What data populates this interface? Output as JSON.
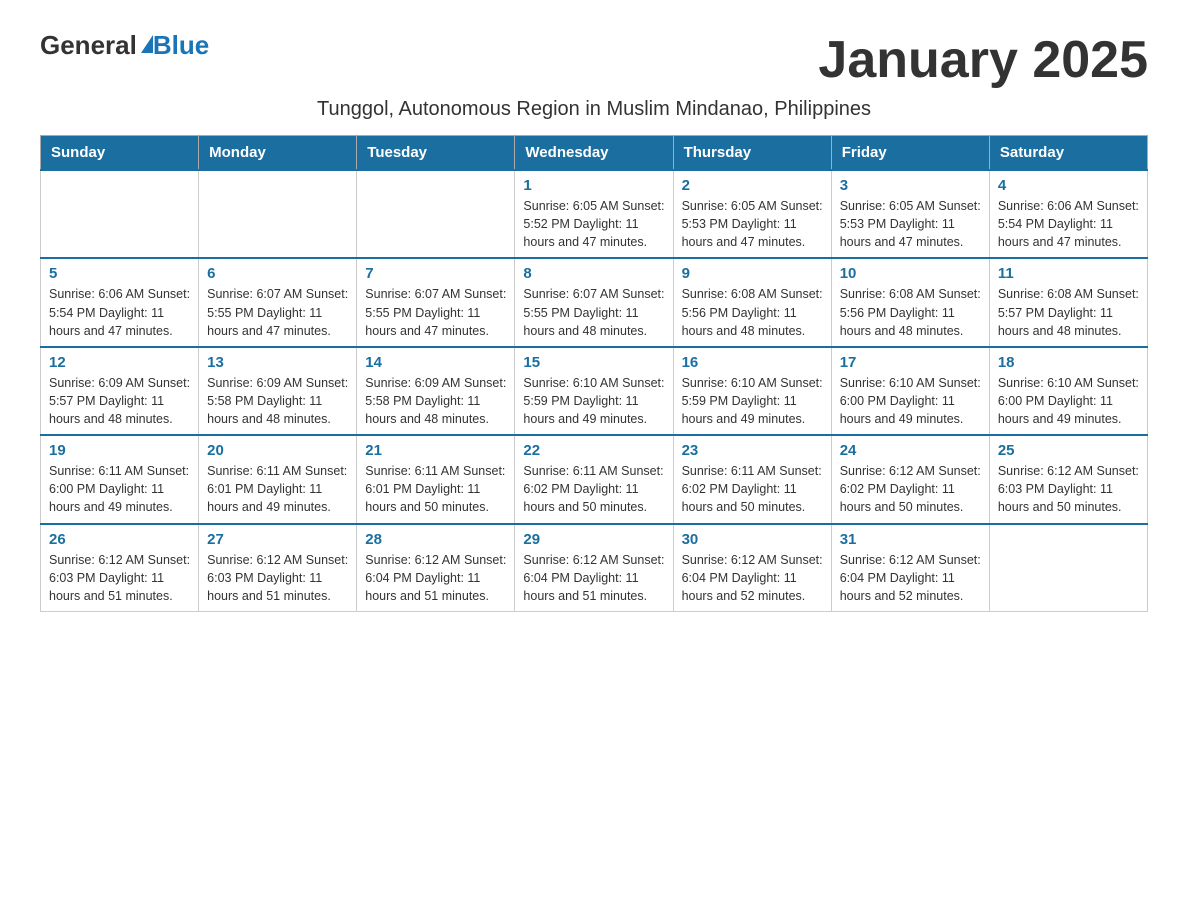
{
  "header": {
    "logo_general": "General",
    "logo_blue": "Blue",
    "month_title": "January 2025",
    "subtitle": "Tunggol, Autonomous Region in Muslim Mindanao, Philippines"
  },
  "weekdays": [
    "Sunday",
    "Monday",
    "Tuesday",
    "Wednesday",
    "Thursday",
    "Friday",
    "Saturday"
  ],
  "weeks": [
    [
      {
        "day": "",
        "info": ""
      },
      {
        "day": "",
        "info": ""
      },
      {
        "day": "",
        "info": ""
      },
      {
        "day": "1",
        "info": "Sunrise: 6:05 AM\nSunset: 5:52 PM\nDaylight: 11 hours and 47 minutes."
      },
      {
        "day": "2",
        "info": "Sunrise: 6:05 AM\nSunset: 5:53 PM\nDaylight: 11 hours and 47 minutes."
      },
      {
        "day": "3",
        "info": "Sunrise: 6:05 AM\nSunset: 5:53 PM\nDaylight: 11 hours and 47 minutes."
      },
      {
        "day": "4",
        "info": "Sunrise: 6:06 AM\nSunset: 5:54 PM\nDaylight: 11 hours and 47 minutes."
      }
    ],
    [
      {
        "day": "5",
        "info": "Sunrise: 6:06 AM\nSunset: 5:54 PM\nDaylight: 11 hours and 47 minutes."
      },
      {
        "day": "6",
        "info": "Sunrise: 6:07 AM\nSunset: 5:55 PM\nDaylight: 11 hours and 47 minutes."
      },
      {
        "day": "7",
        "info": "Sunrise: 6:07 AM\nSunset: 5:55 PM\nDaylight: 11 hours and 47 minutes."
      },
      {
        "day": "8",
        "info": "Sunrise: 6:07 AM\nSunset: 5:55 PM\nDaylight: 11 hours and 48 minutes."
      },
      {
        "day": "9",
        "info": "Sunrise: 6:08 AM\nSunset: 5:56 PM\nDaylight: 11 hours and 48 minutes."
      },
      {
        "day": "10",
        "info": "Sunrise: 6:08 AM\nSunset: 5:56 PM\nDaylight: 11 hours and 48 minutes."
      },
      {
        "day": "11",
        "info": "Sunrise: 6:08 AM\nSunset: 5:57 PM\nDaylight: 11 hours and 48 minutes."
      }
    ],
    [
      {
        "day": "12",
        "info": "Sunrise: 6:09 AM\nSunset: 5:57 PM\nDaylight: 11 hours and 48 minutes."
      },
      {
        "day": "13",
        "info": "Sunrise: 6:09 AM\nSunset: 5:58 PM\nDaylight: 11 hours and 48 minutes."
      },
      {
        "day": "14",
        "info": "Sunrise: 6:09 AM\nSunset: 5:58 PM\nDaylight: 11 hours and 48 minutes."
      },
      {
        "day": "15",
        "info": "Sunrise: 6:10 AM\nSunset: 5:59 PM\nDaylight: 11 hours and 49 minutes."
      },
      {
        "day": "16",
        "info": "Sunrise: 6:10 AM\nSunset: 5:59 PM\nDaylight: 11 hours and 49 minutes."
      },
      {
        "day": "17",
        "info": "Sunrise: 6:10 AM\nSunset: 6:00 PM\nDaylight: 11 hours and 49 minutes."
      },
      {
        "day": "18",
        "info": "Sunrise: 6:10 AM\nSunset: 6:00 PM\nDaylight: 11 hours and 49 minutes."
      }
    ],
    [
      {
        "day": "19",
        "info": "Sunrise: 6:11 AM\nSunset: 6:00 PM\nDaylight: 11 hours and 49 minutes."
      },
      {
        "day": "20",
        "info": "Sunrise: 6:11 AM\nSunset: 6:01 PM\nDaylight: 11 hours and 49 minutes."
      },
      {
        "day": "21",
        "info": "Sunrise: 6:11 AM\nSunset: 6:01 PM\nDaylight: 11 hours and 50 minutes."
      },
      {
        "day": "22",
        "info": "Sunrise: 6:11 AM\nSunset: 6:02 PM\nDaylight: 11 hours and 50 minutes."
      },
      {
        "day": "23",
        "info": "Sunrise: 6:11 AM\nSunset: 6:02 PM\nDaylight: 11 hours and 50 minutes."
      },
      {
        "day": "24",
        "info": "Sunrise: 6:12 AM\nSunset: 6:02 PM\nDaylight: 11 hours and 50 minutes."
      },
      {
        "day": "25",
        "info": "Sunrise: 6:12 AM\nSunset: 6:03 PM\nDaylight: 11 hours and 50 minutes."
      }
    ],
    [
      {
        "day": "26",
        "info": "Sunrise: 6:12 AM\nSunset: 6:03 PM\nDaylight: 11 hours and 51 minutes."
      },
      {
        "day": "27",
        "info": "Sunrise: 6:12 AM\nSunset: 6:03 PM\nDaylight: 11 hours and 51 minutes."
      },
      {
        "day": "28",
        "info": "Sunrise: 6:12 AM\nSunset: 6:04 PM\nDaylight: 11 hours and 51 minutes."
      },
      {
        "day": "29",
        "info": "Sunrise: 6:12 AM\nSunset: 6:04 PM\nDaylight: 11 hours and 51 minutes."
      },
      {
        "day": "30",
        "info": "Sunrise: 6:12 AM\nSunset: 6:04 PM\nDaylight: 11 hours and 52 minutes."
      },
      {
        "day": "31",
        "info": "Sunrise: 6:12 AM\nSunset: 6:04 PM\nDaylight: 11 hours and 52 minutes."
      },
      {
        "day": "",
        "info": ""
      }
    ]
  ]
}
